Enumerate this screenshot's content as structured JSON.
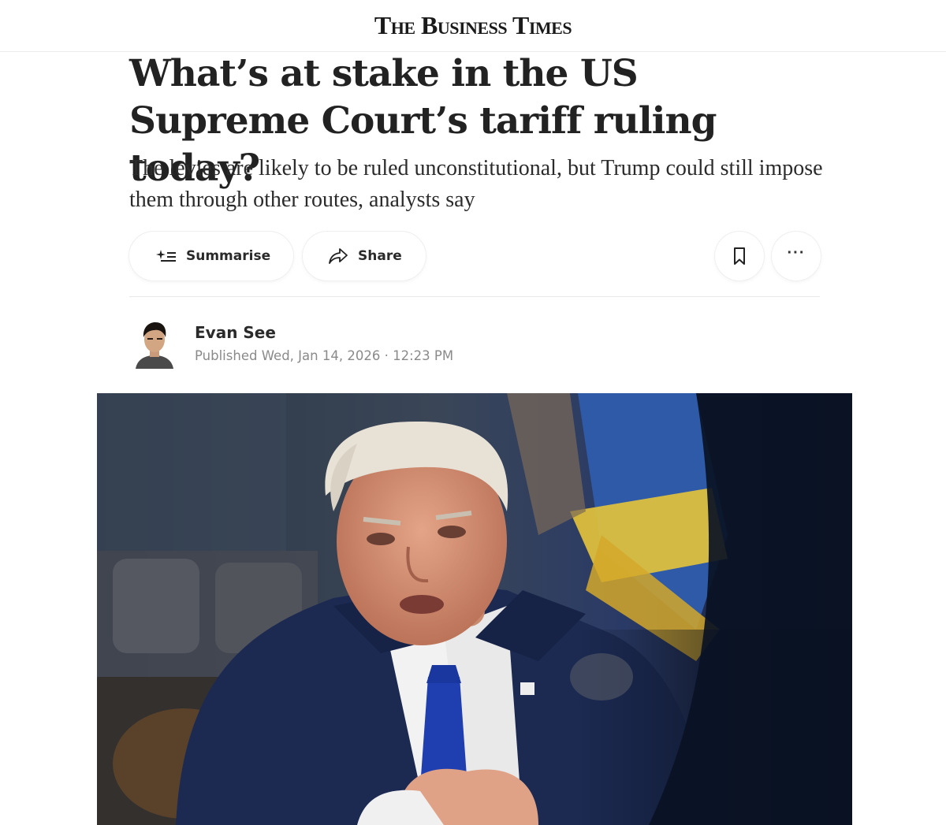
{
  "masthead": {
    "logo_text": "The Business Times"
  },
  "article": {
    "headline": "What’s at stake in the US Supreme Court’s tariff ruling today?",
    "deck": "The levies are likely to be ruled unconstitutional, but Trump could still impose them through other routes, analysts say"
  },
  "actions": {
    "summarise_label": "Summarise",
    "summarise_icon": "sparkle-list-icon",
    "share_label": "Share",
    "share_icon": "share-arrow-icon",
    "bookmark_icon": "bookmark-icon",
    "more_label": "···",
    "more_icon": "more-horizontal-icon"
  },
  "byline": {
    "author": "Evan See",
    "published_prefix": "Published",
    "published_date": "Wed, Jan 14, 2026",
    "separator": "·",
    "published_time": "12:23 PM"
  },
  "colors": {
    "text": "#1a1a1a",
    "muted": "#8a8a8a",
    "border": "#ececec",
    "suit": "#1c2a52",
    "tie": "#1f3fb0"
  }
}
